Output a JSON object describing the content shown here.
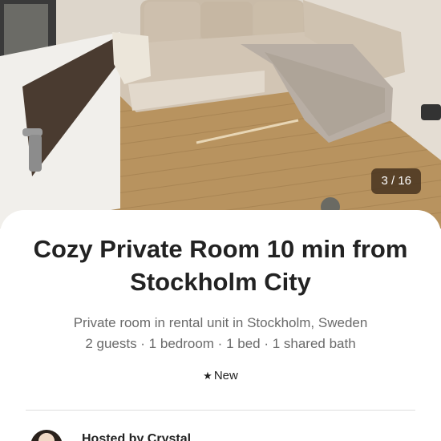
{
  "gallery": {
    "counter": "3 / 16",
    "photo_description_icon": "room-photo"
  },
  "listing": {
    "title": "Cozy Private Room 10 min from Stockholm City",
    "type_location": "Private room in rental unit in Stockholm, Sweden",
    "details": "2 guests · 1 bedroom · 1 bed · 1 shared bath",
    "rating_icon": "star-icon",
    "rating_label": "New"
  },
  "host": {
    "hosted_by": "Hosted by Crystal"
  },
  "colors": {
    "text_primary": "#222222",
    "text_secondary": "#6a6a6a",
    "divider": "#dddddd",
    "counter_bg": "#46321e"
  }
}
